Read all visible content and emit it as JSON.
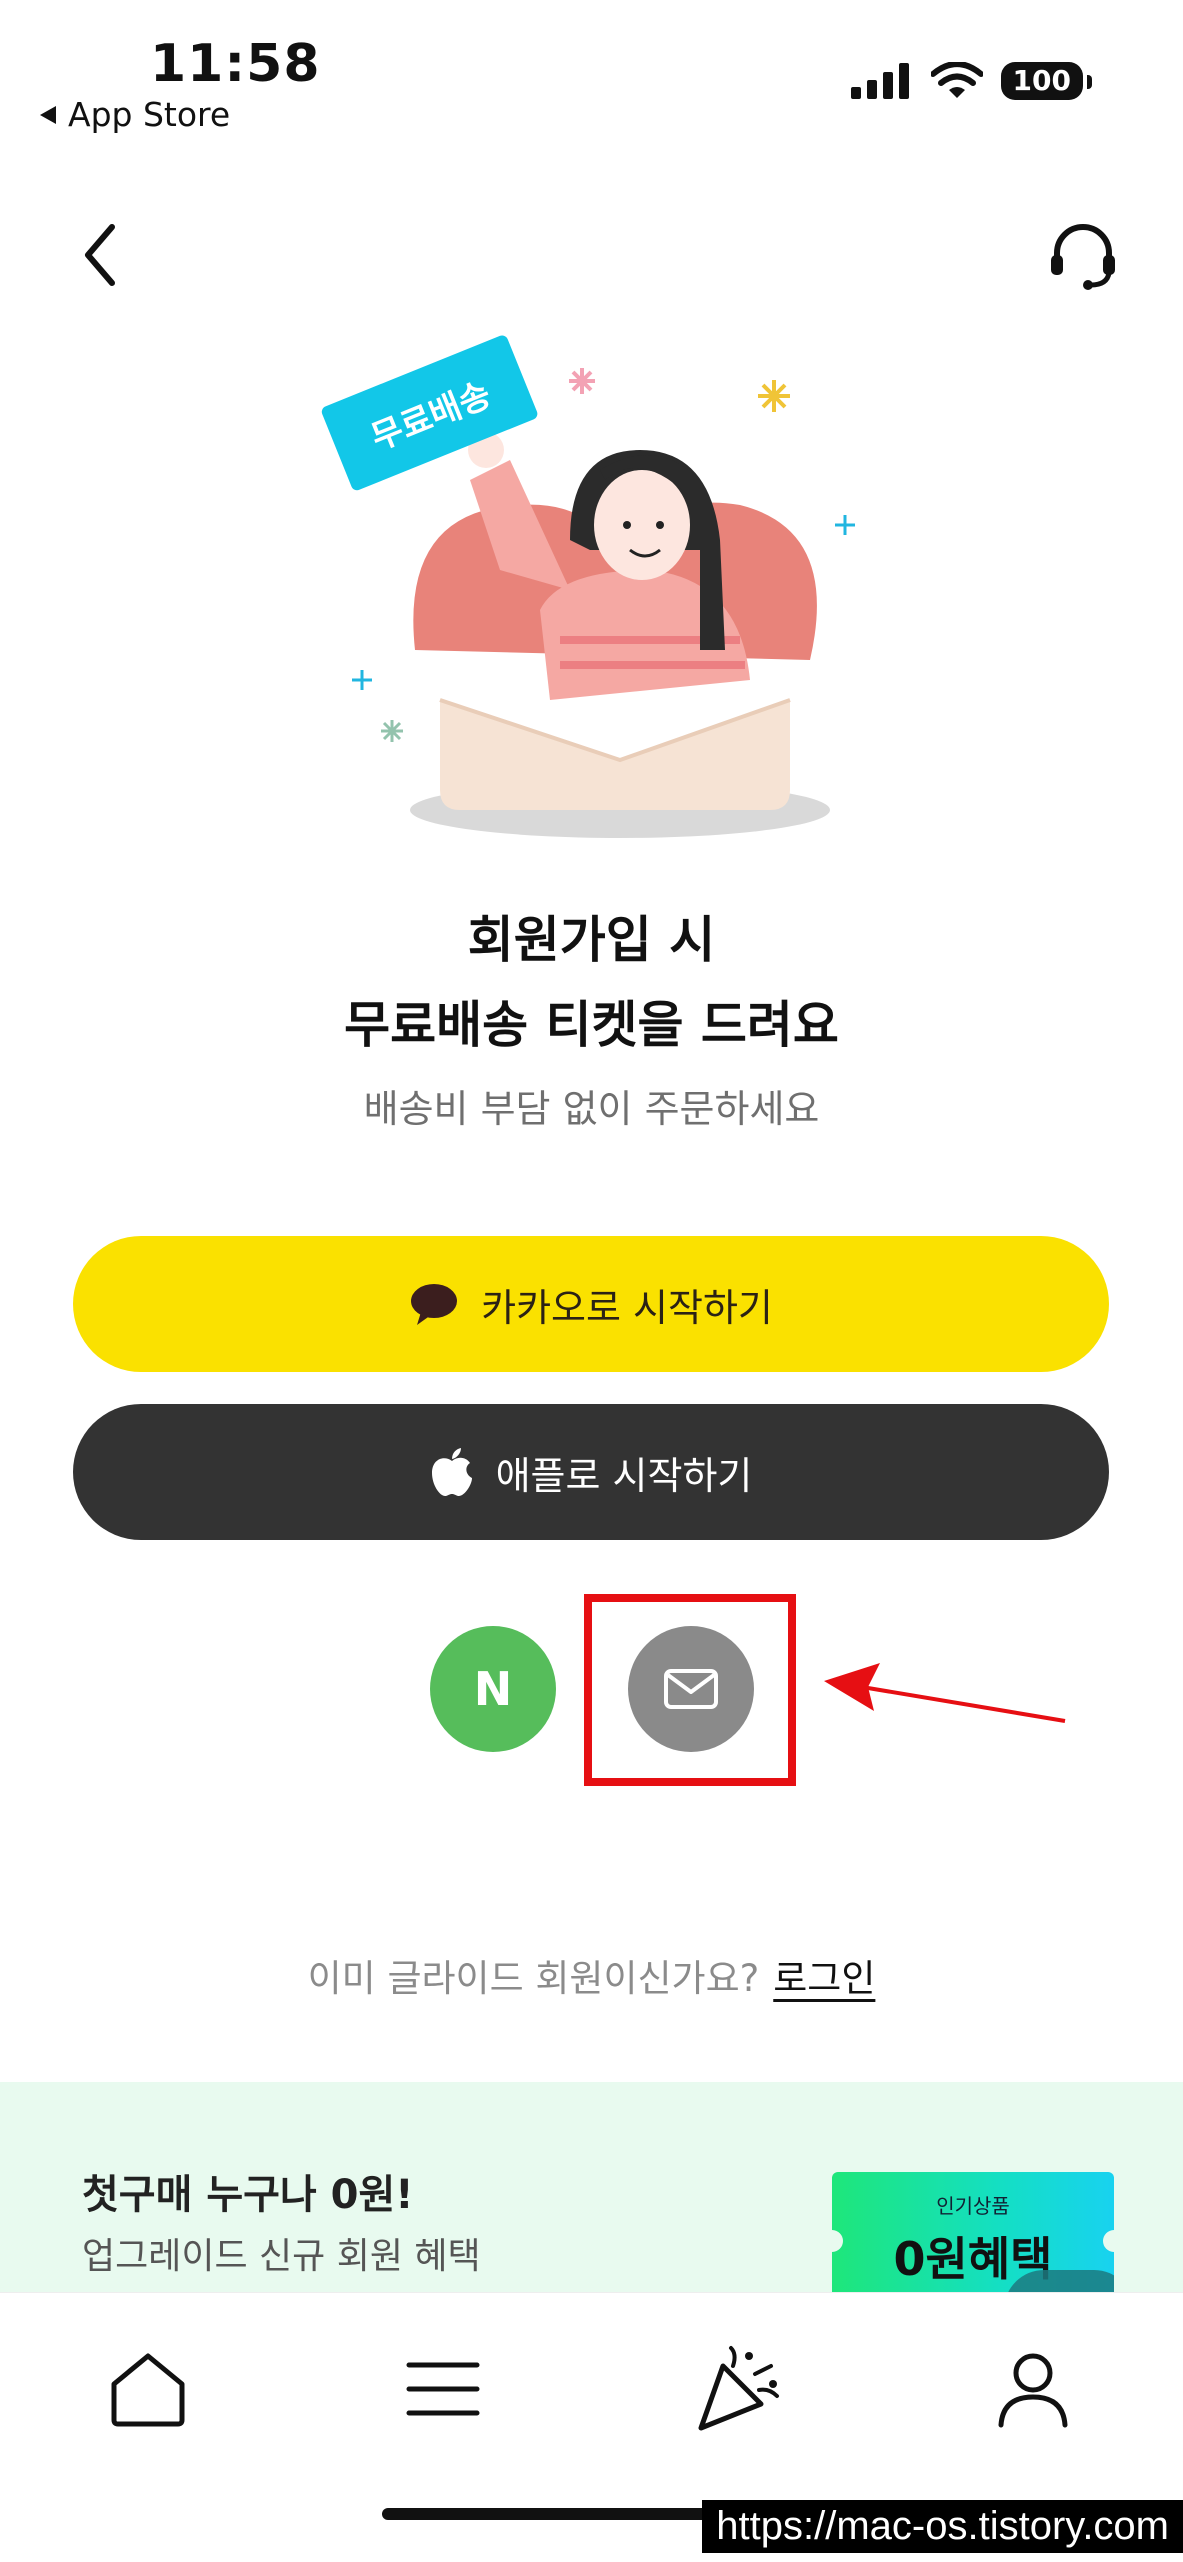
{
  "status_bar": {
    "time": "11:58",
    "back_app": "App Store",
    "battery": "100"
  },
  "hero": {
    "ticket_text": "무료배송"
  },
  "headline": {
    "line1": "회원가입 시",
    "line2": "무료배송 티켓을 드려요",
    "subtitle": "배송비 부담 없이 주문하세요"
  },
  "buttons": {
    "kakao_label": "카카오로 시작하기",
    "apple_label": "애플로 시작하기",
    "naver_letter": "N"
  },
  "login": {
    "prompt": "이미 글라이드 회원이신가요?",
    "link": "로그인"
  },
  "promo": {
    "title": "첫구매 누구나 0원!",
    "subtitle": "업그레이드 신규 회원 혜택",
    "ticket_small": "인기상품",
    "ticket_big": "0원혜택"
  },
  "tabbar": {
    "items": [
      "home-icon",
      "menu-icon",
      "party-icon",
      "profile-icon"
    ]
  },
  "watermark": "https://mac-os.tistory.com",
  "colors": {
    "kakao": "#fae100",
    "apple": "#333333",
    "naver": "#56bd5b",
    "email": "#8a8a8a",
    "highlight": "#e60f13",
    "promo_bg": "#e8faef"
  }
}
